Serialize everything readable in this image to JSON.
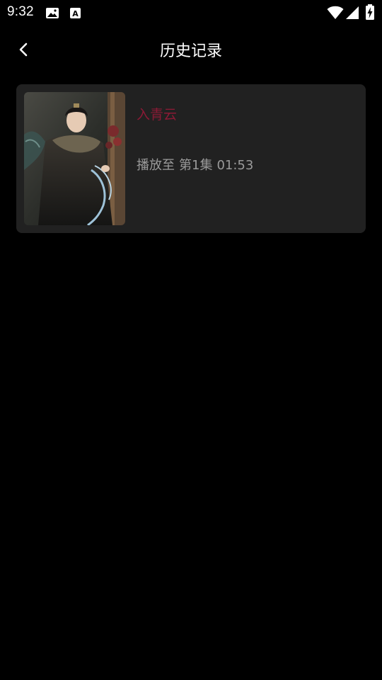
{
  "status_bar": {
    "time": "9:32",
    "icons": [
      "image-notification-icon",
      "font-a-notification-icon",
      "wifi-icon",
      "cell-signal-icon",
      "battery-charging-icon"
    ]
  },
  "header": {
    "back_icon": "chevron-left-icon",
    "title": "历史记录"
  },
  "history": {
    "items": [
      {
        "title": "入青云",
        "progress_prefix": "播放至",
        "episode": "第1集",
        "timestamp": "01:53"
      }
    ]
  },
  "colors": {
    "background": "#000000",
    "card": "#212121",
    "title_accent": "#8a1a35",
    "secondary_text": "#9a9a9a"
  }
}
